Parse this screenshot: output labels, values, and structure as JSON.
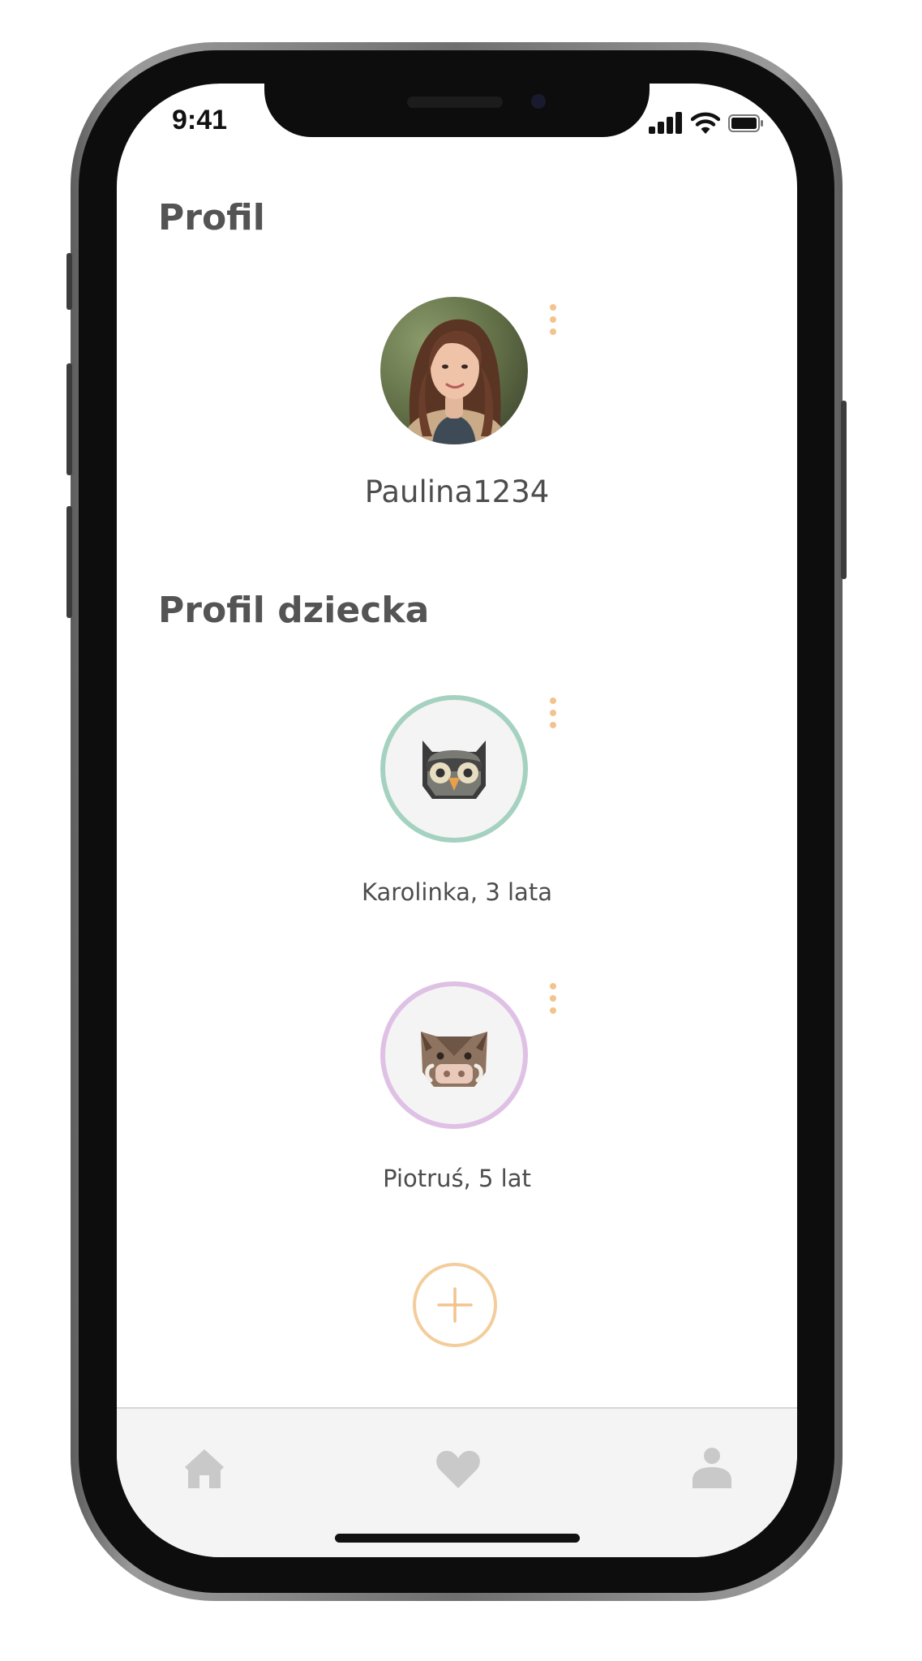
{
  "status_bar": {
    "time": "9:41",
    "icons": [
      "signal-icon",
      "wifi-icon",
      "battery-icon"
    ]
  },
  "profile": {
    "section_title": "Profil",
    "user": {
      "username": "Paulina1234",
      "avatar": "user-photo"
    }
  },
  "children": {
    "section_title": "Profil dziecka",
    "items": [
      {
        "label": "Karolinka, 3 lata",
        "icon": "owl-icon",
        "ring_color": "#a5d2c0"
      },
      {
        "label": "Piotruś, 5 lat",
        "icon": "boar-icon",
        "ring_color": "#dfc1e5"
      }
    ]
  },
  "add_child": {
    "icon": "plus-icon"
  },
  "bottom_nav": {
    "items": [
      {
        "icon": "home-icon"
      },
      {
        "icon": "heart-icon"
      },
      {
        "icon": "person-icon"
      }
    ]
  },
  "colors": {
    "accent": "#f3c38d",
    "heading": "#545454",
    "text": "#4d4d4d",
    "nav_icon": "#c9c9c9",
    "nav_background": "#f4f4f4"
  }
}
